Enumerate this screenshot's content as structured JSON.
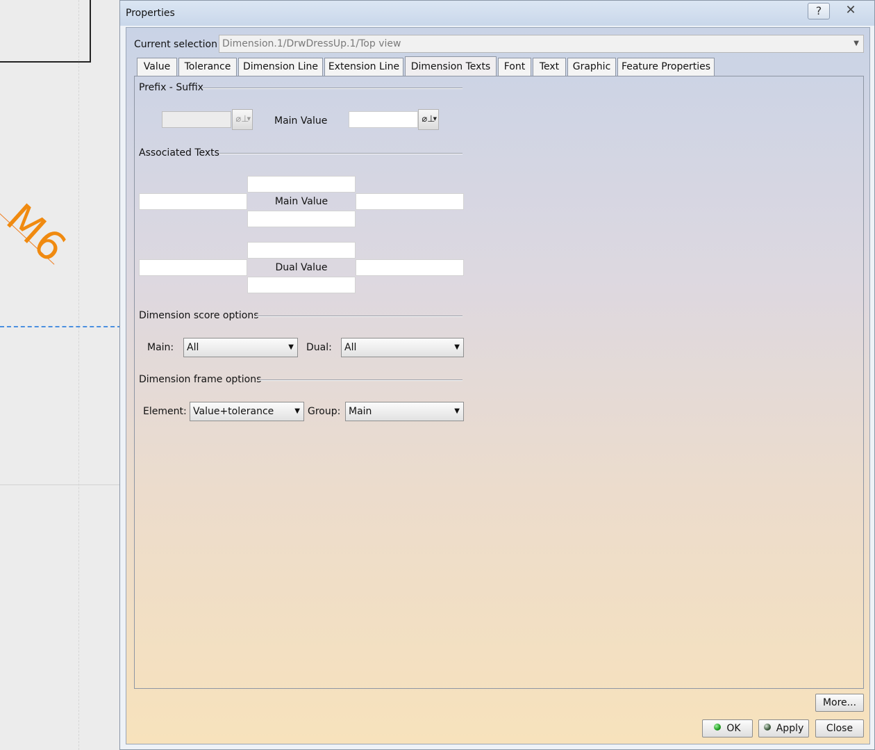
{
  "dialog": {
    "title": "Properties",
    "help_icon": "question-icon",
    "close_icon": "close-icon"
  },
  "selection": {
    "label": "Current selection :",
    "value": "Dimension.1/DrwDressUp.1/Top view"
  },
  "tabs": [
    {
      "label": "Value"
    },
    {
      "label": "Tolerance"
    },
    {
      "label": "Dimension Line"
    },
    {
      "label": "Extension Line"
    },
    {
      "label": "Dimension Texts",
      "active": true
    },
    {
      "label": "Font"
    },
    {
      "label": "Text"
    },
    {
      "label": "Graphic"
    },
    {
      "label": "Feature Properties"
    }
  ],
  "prefix_suffix": {
    "title": "Prefix - Suffix",
    "prefix_value": "",
    "main_value_label": "Main Value",
    "suffix_value": "",
    "symbol_icon": "insert-symbol-icon"
  },
  "associated_texts": {
    "title": "Associated Texts",
    "main_label": "Main Value",
    "dual_label": "Dual Value"
  },
  "score_options": {
    "title": "Dimension score options",
    "main_label": "Main:",
    "main_value": "All",
    "dual_label": "Dual:",
    "dual_value": "All"
  },
  "frame_options": {
    "title": "Dimension frame options",
    "element_label": "Element:",
    "element_value": "Value+tolerance",
    "group_label": "Group:",
    "group_value": "Main"
  },
  "buttons": {
    "more": "More...",
    "ok": "OK",
    "apply": "Apply",
    "close": "Close"
  },
  "background": {
    "annotation_text": "M6"
  },
  "colors": {
    "annotation": "#f08a10",
    "dashed_line": "#4a8fe0"
  }
}
